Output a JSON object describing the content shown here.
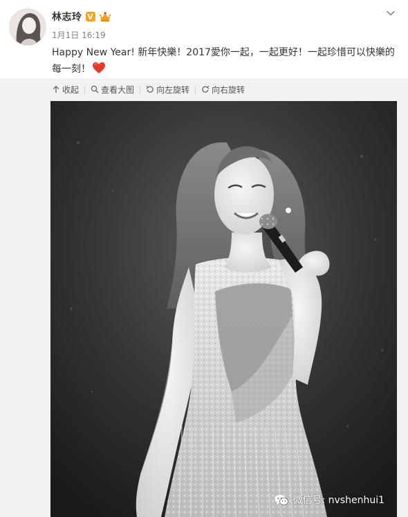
{
  "user": {
    "name": "林志玲",
    "verified_mark": "V",
    "time": "1月1日 16:19"
  },
  "post": {
    "line1": "Happy New Year!  新年快樂！2017愛你一起，一起更好！一起珍惜可以快樂的",
    "line2": "每一刻！"
  },
  "toolbar": {
    "collapse": "收起",
    "view_large": "查看大图",
    "rotate_left": "向左旋转",
    "rotate_right": "向右旋转"
  },
  "watermark": {
    "text": "微信号: nvshenhui1"
  },
  "icons": {
    "verified": "verified-badge-icon",
    "member": "member-crown-icon",
    "heart": "heart-icon",
    "menu": "chevron-down-icon",
    "collapse": "arrow-up-icon",
    "view_large": "magnifier-icon",
    "rotate_left": "rotate-left-icon",
    "rotate_right": "rotate-right-icon",
    "wechat": "wechat-icon"
  },
  "colors": {
    "accent": "#eb7350",
    "verified": "#f7a21a",
    "heart": "#e8362b",
    "panel": "#f2f2f5"
  }
}
